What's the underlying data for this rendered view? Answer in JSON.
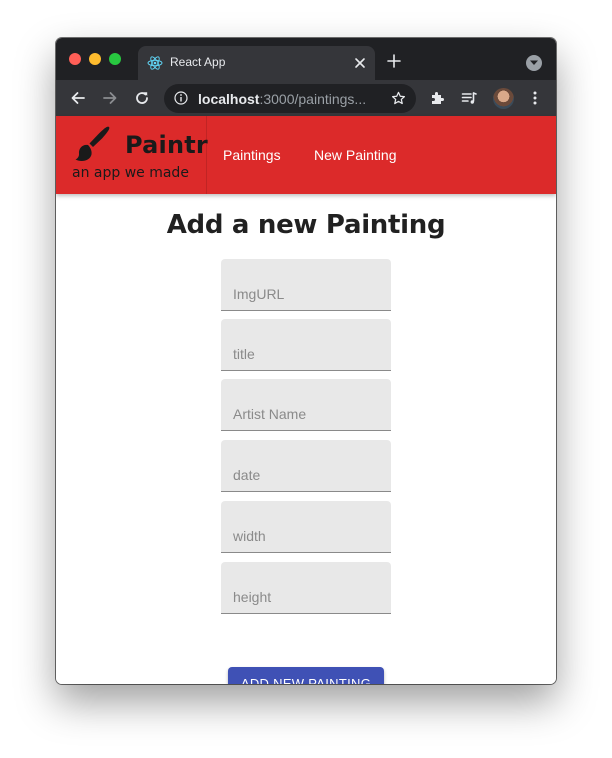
{
  "browser": {
    "tab": {
      "title": "React App"
    },
    "address_bar": {
      "host": "localhost",
      "path": ":3000/paintings..."
    }
  },
  "app": {
    "brand": {
      "name": "Paintr",
      "tagline": "an app we made"
    },
    "nav": [
      {
        "label": "Paintings"
      },
      {
        "label": "New Painting"
      }
    ],
    "accent_color": "#dc2a2a"
  },
  "form": {
    "title": "Add a new Painting",
    "fields": [
      {
        "placeholder": "ImgURL",
        "value": ""
      },
      {
        "placeholder": "title",
        "value": ""
      },
      {
        "placeholder": "Artist Name",
        "value": ""
      },
      {
        "placeholder": "date",
        "value": ""
      },
      {
        "placeholder": "width",
        "value": ""
      },
      {
        "placeholder": "height",
        "value": ""
      }
    ],
    "submit_label": "ADD NEW PAINTING",
    "submit_color": "#3f51b5"
  }
}
